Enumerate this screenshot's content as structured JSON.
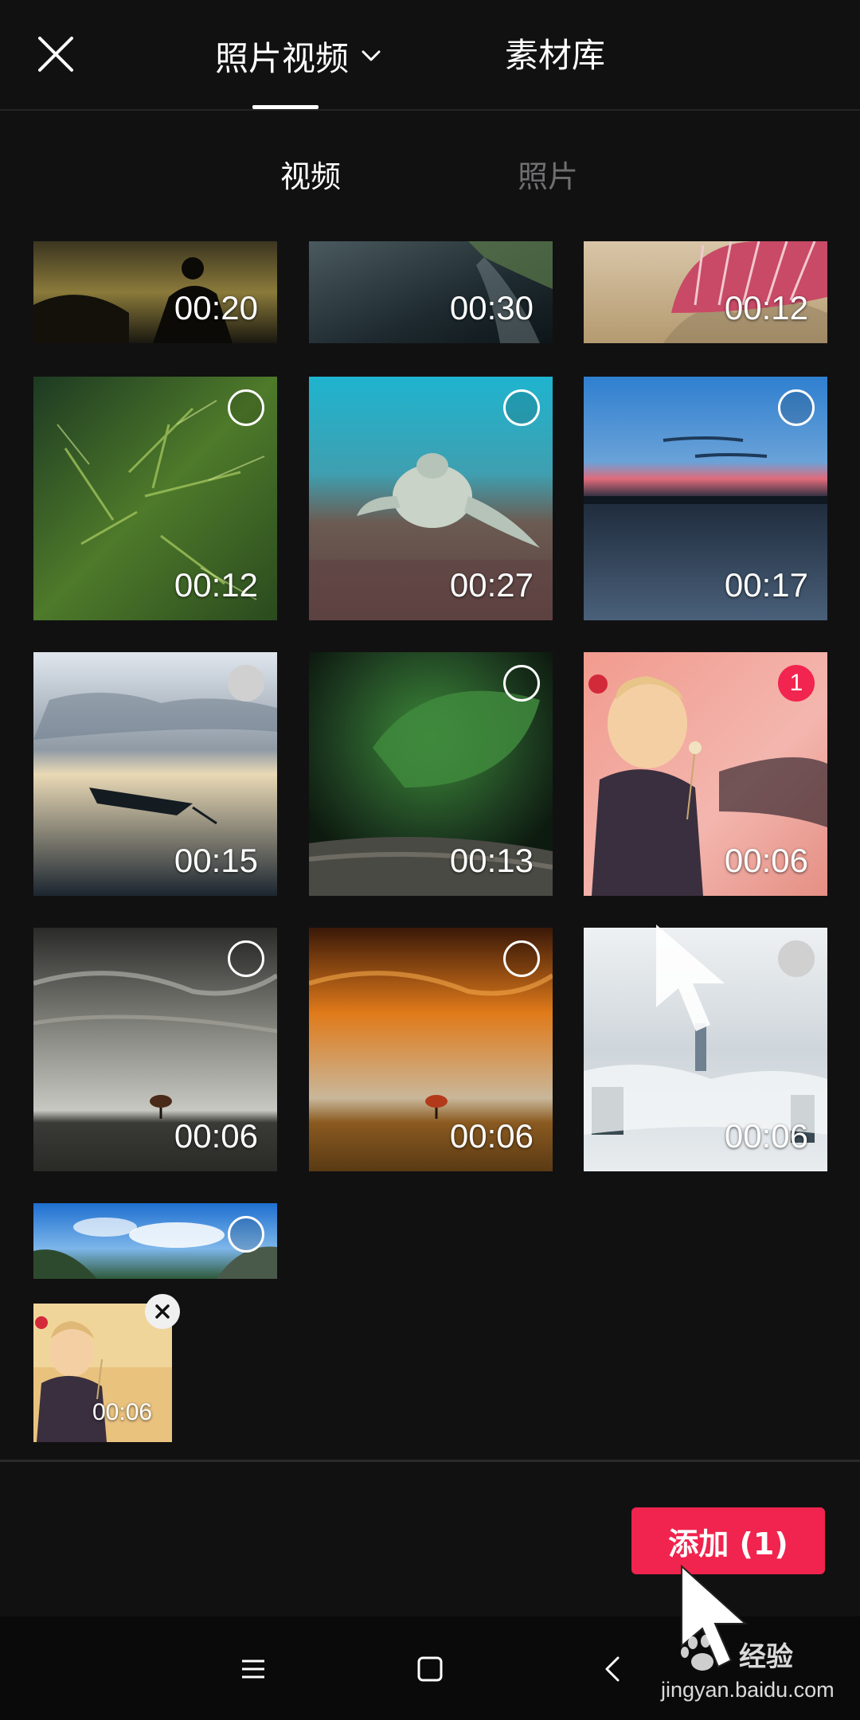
{
  "header": {
    "tab_main_label": "照片视频",
    "tab_library_label": "素材库"
  },
  "subtabs": {
    "video_label": "视频",
    "photo_label": "照片"
  },
  "media": [
    {
      "duration": "00:20",
      "scene": "silhouette-child",
      "selection": ""
    },
    {
      "duration": "00:30",
      "scene": "dark-water",
      "selection": ""
    },
    {
      "duration": "00:12",
      "scene": "seashell-sand",
      "selection": ""
    },
    {
      "duration": "00:12",
      "scene": "pine-branches",
      "selection": "empty"
    },
    {
      "duration": "00:27",
      "scene": "sea-turtle",
      "selection": "empty"
    },
    {
      "duration": "00:17",
      "scene": "sunset-lake",
      "selection": "empty"
    },
    {
      "duration": "00:15",
      "scene": "boat-lake",
      "selection": "empty"
    },
    {
      "duration": "00:13",
      "scene": "green-leaf",
      "selection": "empty"
    },
    {
      "duration": "00:06",
      "scene": "girl-flower",
      "selection": "1"
    },
    {
      "duration": "00:06",
      "scene": "grey-sky-tree",
      "selection": "empty"
    },
    {
      "duration": "00:06",
      "scene": "orange-sky-tree",
      "selection": "empty"
    },
    {
      "duration": "00:06",
      "scene": "city-fog",
      "selection": "empty"
    },
    {
      "duration": "",
      "scene": "blue-sky-mountain",
      "selection": "empty"
    }
  ],
  "tray": {
    "duration": "00:06",
    "scene": "girl-flower"
  },
  "actions": {
    "add_label": "添加 (1)"
  },
  "watermark": {
    "title": "经验",
    "url": "jingyan.baidu.com"
  },
  "colors": {
    "background": "#121112",
    "accent": "#f0244e",
    "inactive_text": "#6f6e70"
  },
  "icons": {
    "close": "close-icon",
    "dropdown": "chevron-down-icon",
    "remove": "close-icon",
    "nav_menu": "menu-icon",
    "nav_home": "home-icon",
    "nav_back": "back-icon"
  }
}
